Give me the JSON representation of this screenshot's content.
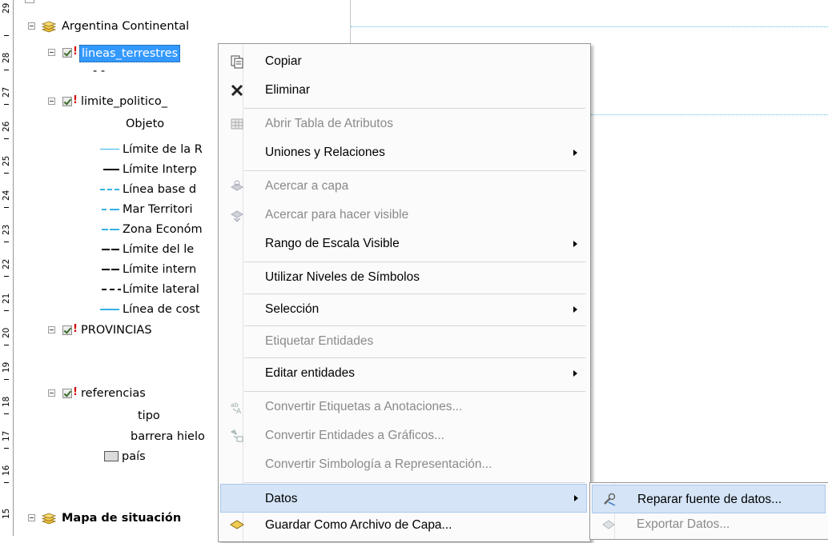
{
  "ruler": {
    "labels": [
      "29",
      "28",
      "27",
      "26",
      "25",
      "24",
      "23",
      "22",
      "21",
      "20",
      "19",
      "18",
      "17",
      "16",
      "15"
    ]
  },
  "toc": {
    "data_frame_1": "Argentina Continental",
    "layer_1": {
      "name": "lineas_terrestres",
      "legend": "- -"
    },
    "layer_2": {
      "name": "limite_politico_",
      "field": "Objeto",
      "classes": [
        "Límite de la R",
        "Límite Interp",
        "Línea base d",
        "Mar Territori",
        "Zona Económ",
        "Límite del le",
        "Límite intern",
        "Límite lateral",
        "Línea de cost"
      ]
    },
    "layer_3": {
      "name": "PROVINCIAS"
    },
    "layer_4": {
      "name": "referencias",
      "field": "tipo",
      "value": "barrera hielo",
      "legend": "país"
    },
    "data_frame_2": "Mapa de situación"
  },
  "context_menu": {
    "items": [
      {
        "label": "Copiar",
        "icon": "copy-icon"
      },
      {
        "label": "Eliminar",
        "icon": "delete-icon"
      },
      {
        "label": "Abrir Tabla de Atributos",
        "icon": "table-icon",
        "disabled": true
      },
      {
        "label": "Uniones y Relaciones",
        "submenu": true
      },
      {
        "label": "Acercar a capa",
        "icon": "zoom-layer-icon",
        "disabled": true
      },
      {
        "label": "Acercar para hacer visible",
        "icon": "zoom-visible-icon",
        "disabled": true
      },
      {
        "label": "Rango de Escala Visible",
        "submenu": true
      },
      {
        "label": "Utilizar Niveles de Símbolos"
      },
      {
        "label": "Selección",
        "submenu": true
      },
      {
        "label": "Etiquetar Entidades",
        "disabled": true
      },
      {
        "label": "Editar entidades",
        "submenu": true
      },
      {
        "label": "Convertir Etiquetas a Anotaciones...",
        "icon": "convert-labels-icon",
        "disabled": true
      },
      {
        "label": "Convertir Entidades a Gráficos...",
        "icon": "convert-features-icon",
        "disabled": true
      },
      {
        "label": "Convertir Simbología a Representación...",
        "disabled": true
      },
      {
        "label": "Datos",
        "submenu": true,
        "highlighted": true
      },
      {
        "label": "Guardar Como Archivo de Capa...",
        "icon": "layer-file-icon"
      }
    ]
  },
  "submenu": {
    "items": [
      {
        "label": "Reparar fuente de datos...",
        "icon": "repair-icon"
      },
      {
        "label": "Exportar Datos...",
        "icon": "export-icon",
        "disabled": true
      }
    ]
  },
  "colors": {
    "selection": "#3399ff",
    "menu_highlight": "#d5e4f7",
    "legend_blue": "#35b2e5",
    "warning_red": "#d40000"
  }
}
